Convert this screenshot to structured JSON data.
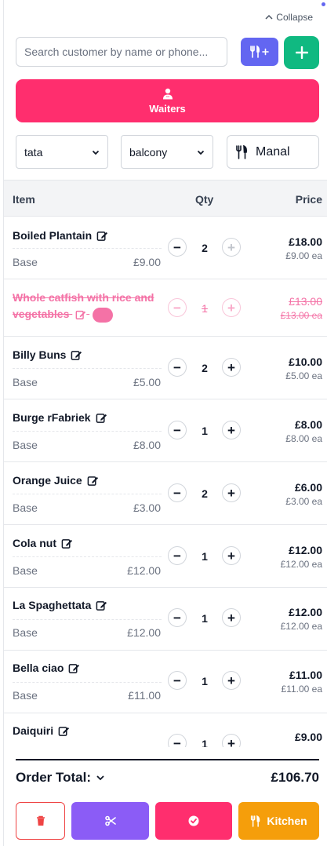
{
  "header": {
    "collapse_label": "Collapse"
  },
  "search": {
    "placeholder": "Search customer by name or phone..."
  },
  "waiters": {
    "label": "Waiters"
  },
  "selectors": {
    "first": "tata",
    "second": "balcony",
    "third": "Manal"
  },
  "table": {
    "headers": {
      "item": "Item",
      "qty": "Qty",
      "price": "Price"
    },
    "rows": [
      {
        "name": "Boiled Plantain",
        "base_label": "Base",
        "base_price": "£9.00",
        "qty": "2",
        "price": "£18.00",
        "each": "£9.00 ea",
        "voided": false
      },
      {
        "name": "Whole catfish with rice and vegetables",
        "base_label": "",
        "base_price": "",
        "qty": "1",
        "price": "£13.00",
        "each": "£13.00 ea",
        "voided": true
      },
      {
        "name": "Billy Buns",
        "base_label": "Base",
        "base_price": "£5.00",
        "qty": "2",
        "price": "£10.00",
        "each": "£5.00 ea",
        "voided": false
      },
      {
        "name": "Burge rFabriek",
        "base_label": "Base",
        "base_price": "£8.00",
        "qty": "1",
        "price": "£8.00",
        "each": "£8.00 ea",
        "voided": false
      },
      {
        "name": "Orange Juice",
        "base_label": "Base",
        "base_price": "£3.00",
        "qty": "2",
        "price": "£6.00",
        "each": "£3.00 ea",
        "voided": false
      },
      {
        "name": "Cola nut",
        "base_label": "Base",
        "base_price": "£12.00",
        "qty": "1",
        "price": "£12.00",
        "each": "£12.00 ea",
        "voided": false
      },
      {
        "name": "La Spaghettata",
        "base_label": "Base",
        "base_price": "£12.00",
        "qty": "1",
        "price": "£12.00",
        "each": "£12.00 ea",
        "voided": false
      },
      {
        "name": "Bella ciao",
        "base_label": "Base",
        "base_price": "£11.00",
        "qty": "1",
        "price": "£11.00",
        "each": "£11.00 ea",
        "voided": false
      },
      {
        "name": "Daiquiri",
        "base_label": "",
        "base_price": "",
        "qty": "1",
        "price": "£9.00",
        "each": "",
        "voided": false
      }
    ]
  },
  "total": {
    "label": "Order Total:",
    "value": "£106.70"
  },
  "actions": {
    "kitchen_label": "Kitchen"
  },
  "colors": {
    "accent_pink": "#ff2e6e",
    "indigo": "#6366f1",
    "green": "#10b981",
    "purple": "#8b5cf6",
    "amber": "#f59e0b",
    "danger": "#ef4444"
  }
}
